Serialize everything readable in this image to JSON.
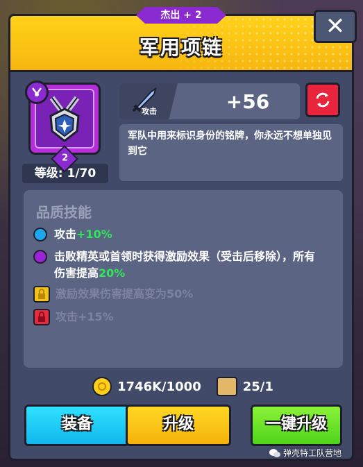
{
  "header": {
    "rarity": "杰出 + 2",
    "title": "军用项链"
  },
  "item": {
    "stars": "2",
    "level_text": "等级: 1/70"
  },
  "stat": {
    "label": "攻击",
    "value": "+56"
  },
  "description": "军队中用来标识身份的铭牌，你永远不想单独见到它",
  "skills": {
    "title": "品质技能",
    "items": [
      {
        "prefix": "攻击",
        "highlight": "+10%",
        "suffix": "",
        "state": "unlocked",
        "color": "#1fa8f0"
      },
      {
        "prefix": "击败精英或首领时获得激励效果（受击后移除），所有伤害提高",
        "highlight": "20%",
        "suffix": "",
        "state": "unlocked",
        "color": "#9b22d8"
      },
      {
        "prefix": "激励效果伤害提高变为50%",
        "highlight": "",
        "suffix": "",
        "state": "locked",
        "color": "#f2c21a"
      },
      {
        "prefix": "攻击+15%",
        "highlight": "",
        "suffix": "",
        "state": "locked",
        "color": "#e82a3c"
      }
    ]
  },
  "resources": {
    "coins": "1746K/1000",
    "scrolls": "25/1"
  },
  "buttons": {
    "equip": "装备",
    "upgrade": "升级",
    "upgrade_all": "一键升级"
  },
  "watermark": "弹壳特工队营地",
  "colors": {
    "header": "#f7b60e",
    "panel": "#414a68",
    "rarity": "#8a2ad0",
    "highlight_green": "#2ee85a"
  }
}
